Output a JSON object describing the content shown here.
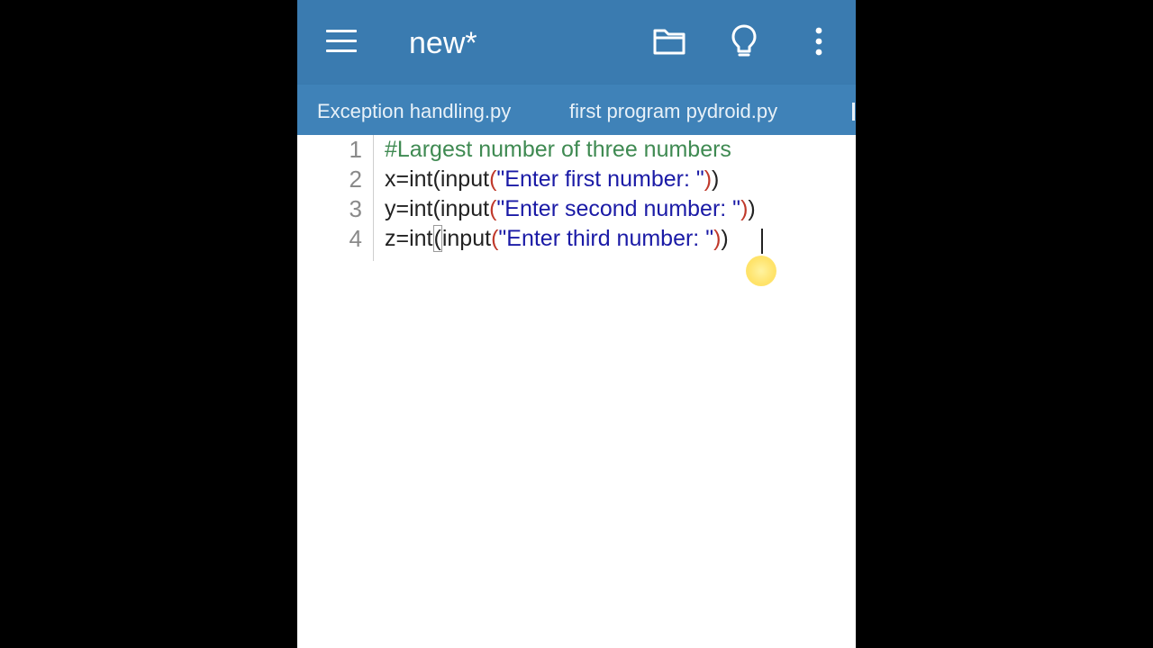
{
  "app_bar": {
    "title": "new*",
    "background_color": "#3a7bb0",
    "icons": [
      "menu-icon",
      "folder-icon",
      "lightbulb-icon",
      "more-vert-icon"
    ]
  },
  "tabs": [
    {
      "label": "Exception handling.py"
    },
    {
      "label": "first program pydroid.py"
    }
  ],
  "editor": {
    "line_numbers": [
      "1",
      "2",
      "3",
      "4"
    ],
    "lines": {
      "l1_comment": "#Largest number of three numbers",
      "l2_pre": "x=int",
      "l2_p1": "(",
      "l2_mid": "input",
      "l2_p2": "(",
      "l2_str": "\"Enter first number: \"",
      "l2_p3": ")",
      "l2_p4": ")",
      "l3_pre": "y=int",
      "l3_p1": "(",
      "l3_mid": "input",
      "l3_p2": "(",
      "l3_str": "\"Enter second number: \"",
      "l3_p3": ")",
      "l3_p4": ")",
      "l4_pre": "z=int",
      "l4_p1": "(",
      "l4_mid": "input",
      "l4_p2": "(",
      "l4_str": "\"Enter third number: \"",
      "l4_p3": ")",
      "l4_p4": ")"
    },
    "colors": {
      "comment": "#3f8a52",
      "string": "#1a1aa6",
      "paren": "#c0392b"
    }
  }
}
